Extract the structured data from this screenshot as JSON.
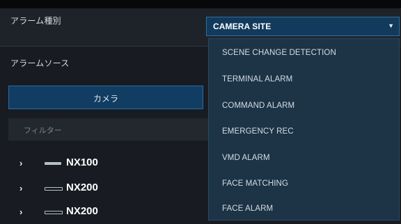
{
  "alarm_type": {
    "label": "アラーム種別",
    "selected": "CAMERA SITE",
    "options": [
      "SCENE CHANGE DETECTION",
      "TERMINAL ALARM",
      "COMMAND ALARM",
      "EMERGENCY REC",
      "VMD ALARM",
      "FACE MATCHING",
      "FACE ALARM"
    ]
  },
  "alarm_source": {
    "label": "アラームソース",
    "camera_button": "カメラ",
    "filter_placeholder": "フィルター",
    "tree": [
      {
        "label": "NX100",
        "icon": "device-icon"
      },
      {
        "label": "NX200",
        "icon": "device-outline-icon"
      },
      {
        "label": "NX200",
        "icon": "device-outline-icon"
      }
    ]
  },
  "colors": {
    "accent": "#123a5c",
    "dropdown_bg": "#1d3346",
    "background": "#15181d"
  }
}
